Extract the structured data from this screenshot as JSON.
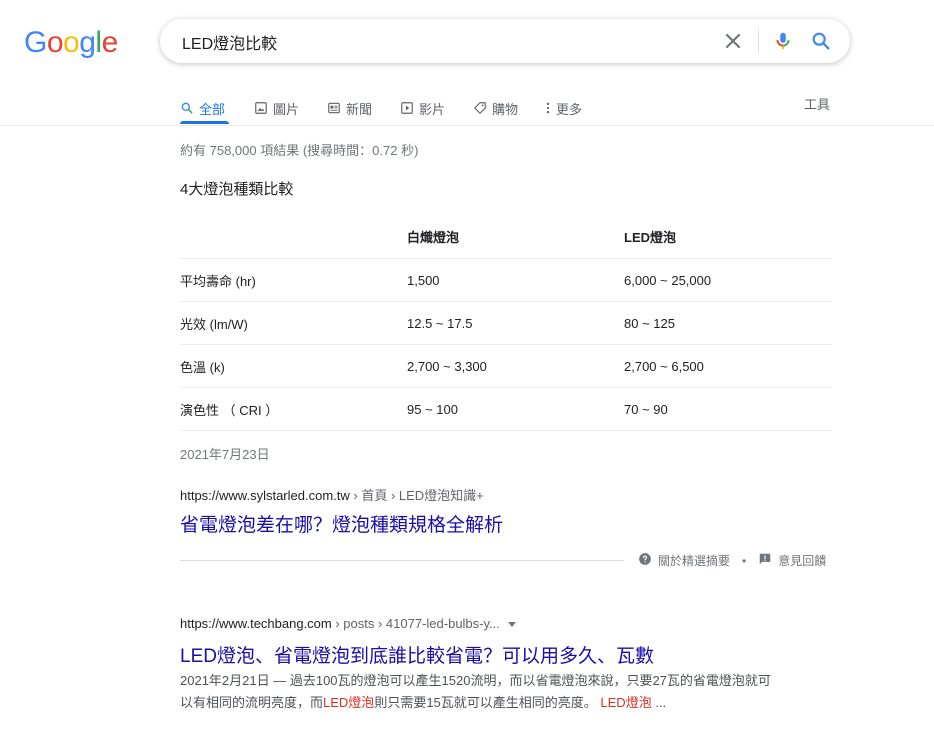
{
  "logo": {
    "letters": [
      "G",
      "o",
      "o",
      "g",
      "l",
      "e"
    ]
  },
  "search": {
    "query": "LED燈泡比較"
  },
  "tabs": [
    {
      "label": "全部",
      "icon": "search-icon"
    },
    {
      "label": "圖片",
      "icon": "image-icon"
    },
    {
      "label": "新聞",
      "icon": "news-icon"
    },
    {
      "label": "影片",
      "icon": "video-icon"
    },
    {
      "label": "購物",
      "icon": "tag-icon"
    },
    {
      "label": "更多",
      "icon": "more-vert-icon"
    }
  ],
  "tools_label": "工具",
  "stats": "約有 758,000 項結果 (搜尋時間：0.72 秒)",
  "snippet": {
    "title": "4大燈泡種類比較",
    "headers": [
      "",
      "白熾燈泡",
      "LED燈泡"
    ],
    "rows": [
      [
        "平均壽命 (hr)",
        "1,500",
        "6,000 ~ 25,000"
      ],
      [
        "光效 (lm/W)",
        "12.5 ~ 17.5",
        "80 ~ 125"
      ],
      [
        "色溫 (k)",
        "2,700 ~ 3,300",
        "2,700 ~ 6,500"
      ],
      [
        "演色性 （ CRI ）",
        "95 ~ 100",
        "70 ~ 90"
      ]
    ],
    "date": "2021年7月23日",
    "cite_domain": "https://www.sylstarled.com.tw",
    "cite_path": " › 首頁 › LED燈泡知識+",
    "result_title": "省電燈泡差在哪？燈泡種類規格全解析"
  },
  "feedback": {
    "about": "關於精選摘要",
    "separator": "•",
    "feedback": "意見回饋"
  },
  "result2": {
    "cite_domain": "https://www.techbang.com",
    "cite_path": " › posts › 41077-led-bulbs-y...",
    "title": "LED燈泡、省電燈泡到底誰比較省電？可以用多久、瓦數",
    "desc_date": "2021年2月21日 —",
    "desc_part1": " 過去100瓦的燈泡可以產生1520流明，而以省電燈泡來說，只要27瓦的省電燈泡就可以有相同的流明亮度，而",
    "desc_hl1": "LED燈泡",
    "desc_part2": "則只需要15瓦就可以產生相同的亮度。",
    "desc_hl2": "LED燈泡",
    "desc_end": " ..."
  },
  "colors": {
    "link": "#1a0dab",
    "accent": "#1a73e8",
    "highlight": "#d93025"
  }
}
